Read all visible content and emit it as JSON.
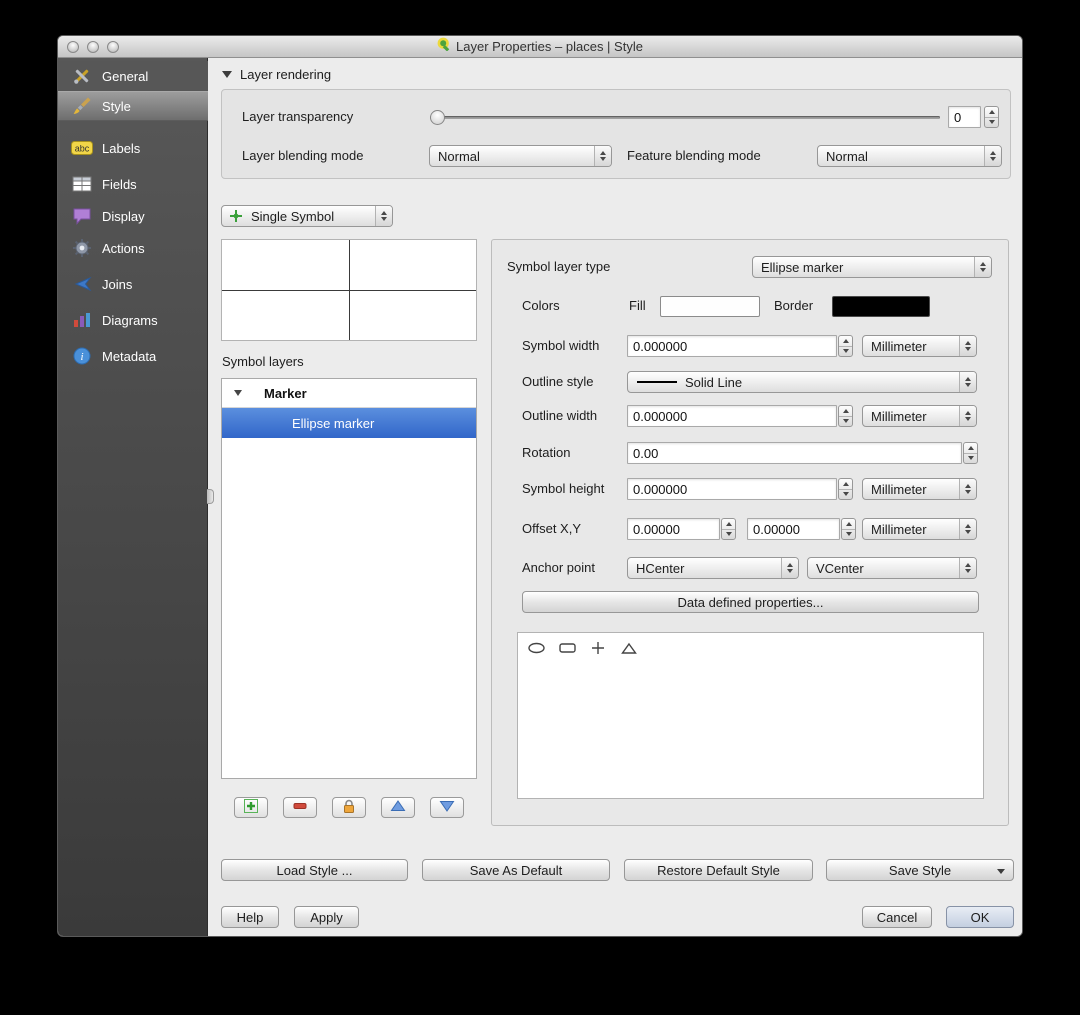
{
  "window": {
    "title": "Layer Properties – places | Style"
  },
  "sidebar": {
    "items": [
      {
        "label": "General",
        "icon": "tools-icon"
      },
      {
        "label": "Style",
        "icon": "paintbrush-icon",
        "selected": true
      },
      {
        "label": "Labels",
        "icon": "abc-label-icon"
      },
      {
        "label": "Fields",
        "icon": "table-icon"
      },
      {
        "label": "Display",
        "icon": "speech-bubble-icon"
      },
      {
        "label": "Actions",
        "icon": "gear-icon"
      },
      {
        "label": "Joins",
        "icon": "join-arrow-icon"
      },
      {
        "label": "Diagrams",
        "icon": "bar-chart-icon"
      },
      {
        "label": "Metadata",
        "icon": "info-icon"
      }
    ]
  },
  "layer_rendering": {
    "section_label": "Layer rendering",
    "transparency_label": "Layer transparency",
    "transparency_value": "0",
    "blending_label": "Layer blending mode",
    "blending_value": "Normal",
    "feature_blending_label": "Feature blending mode",
    "feature_blending_value": "Normal"
  },
  "symbol": {
    "renderer_value": "Single Symbol",
    "symbol_layers_label": "Symbol layers",
    "tree": {
      "group_label": "Marker",
      "layer_label": "Ellipse marker",
      "layer_selected": true
    },
    "tool_icons": [
      "add-symbol-layer",
      "remove-symbol-layer",
      "lock-color",
      "move-up",
      "move-down"
    ]
  },
  "properties": {
    "symbol_layer_type_label": "Symbol layer type",
    "symbol_layer_type_value": "Ellipse marker",
    "colors_label": "Colors",
    "fill_label": "Fill",
    "border_label": "Border",
    "symbol_width_label": "Symbol width",
    "symbol_width_value": "0.000000",
    "outline_style_label": "Outline style",
    "outline_style_value": "Solid Line",
    "outline_width_label": "Outline width",
    "outline_width_value": "0.000000",
    "rotation_label": "Rotation",
    "rotation_value": "0.00",
    "symbol_height_label": "Symbol height",
    "symbol_height_value": "0.000000",
    "offset_label": "Offset X,Y",
    "offset_x_value": "0.00000",
    "offset_y_value": "0.00000",
    "anchor_label": "Anchor point",
    "anchor_h_value": "HCenter",
    "anchor_v_value": "VCenter",
    "unit_value": "Millimeter",
    "data_defined_button": "Data defined properties...",
    "presets": [
      "ellipse-preset",
      "rounded-rect-preset",
      "cross-preset",
      "triangle-preset"
    ]
  },
  "footer": {
    "load_style": "Load Style ...",
    "save_as_default": "Save As Default",
    "restore_default": "Restore Default Style",
    "save_style": "Save Style",
    "help": "Help",
    "apply": "Apply",
    "cancel": "Cancel",
    "ok": "OK"
  },
  "colors": {
    "selection_blue": "#3f74d2",
    "fill_swatch": "#ffffff",
    "border_swatch": "#000000",
    "sidebar_bg": "#474747"
  }
}
